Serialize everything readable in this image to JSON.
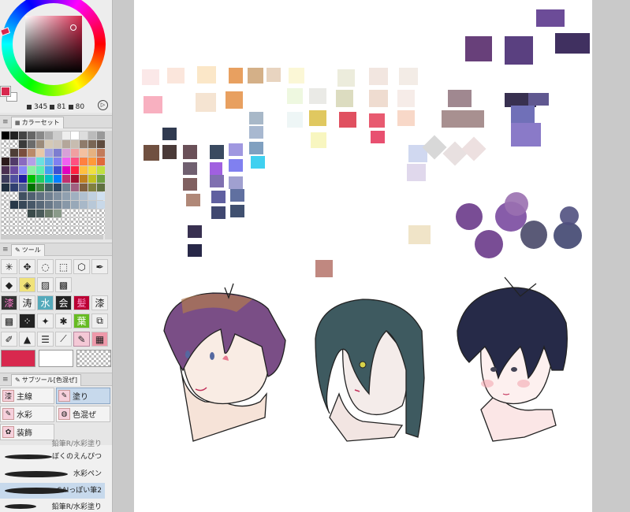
{
  "color_panel": {
    "hsv_readout": [
      "345",
      "81",
      "80"
    ],
    "fg_color": "#d8284e",
    "bg_color": "#ffffff"
  },
  "color_set": {
    "tab_label": "カラーセット"
  },
  "tools": {
    "tab_label": "ツール"
  },
  "sub_tools": {
    "tab_label": "サブツール[色混ぜ]",
    "brushes": [
      {
        "label": "主線"
      },
      {
        "label": "塗り"
      },
      {
        "label": "水彩"
      },
      {
        "label": "色混ぜ"
      },
      {
        "label": "装飾"
      }
    ],
    "strokes": [
      {
        "label": "ぼくのえんぴつ"
      },
      {
        "label": "水彩ペン"
      },
      {
        "label": "SAIっぽい筆2"
      },
      {
        "label": "鉛筆R/水彩塗り"
      }
    ],
    "partial_label": "鉛筆R/水彩塗り"
  },
  "accent_colors": {
    "selected_tool": "#f4c8d6",
    "selected_item": "#c7d9ec"
  }
}
